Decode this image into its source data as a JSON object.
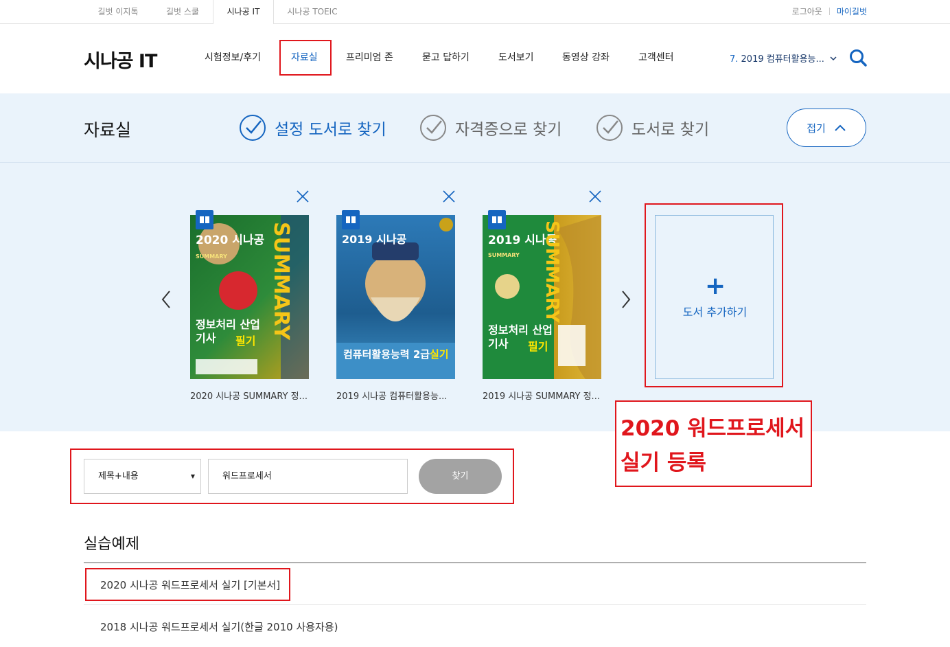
{
  "topbar": {
    "site_tabs": [
      "길벗 이지톡",
      "길벗 스쿨",
      "시나공 IT",
      "시나공 TOEIC"
    ],
    "logout": "로그아웃",
    "mypage": "마이길벗"
  },
  "header": {
    "logo": "시나공 IT",
    "nav": [
      "시험정보/후기",
      "자료실",
      "프리미엄 존",
      "묻고 답하기",
      "도서보기",
      "동영상 강좌",
      "고객센터"
    ],
    "book_select_num": "7.",
    "book_select_text": " 2019 컴퓨터활용능..."
  },
  "band": {
    "title": "자료실",
    "filters": [
      "설정 도서로 찾기",
      "자격증으로 찾기",
      "도서로 찾기"
    ],
    "fold_label": "접기"
  },
  "books": [
    {
      "title": "2020 시나공 SUMMARY 정...",
      "cover": {
        "series": "2020 시나공",
        "sub": "SUMMARY",
        "name": "정보처리 산업기사",
        "highlight": "필기",
        "side": "SUMMARY",
        "bg": "#2e8b3a"
      }
    },
    {
      "title": "2019 시나공 컴퓨터활용능...",
      "cover": {
        "series": "2019 시나공",
        "sub": "",
        "name": "컴퓨터활용능력 2급",
        "highlight": "실기",
        "side": "",
        "bg": "#2d7ab8"
      }
    },
    {
      "title": "2019 시나공 SUMMARY 정...",
      "cover": {
        "series": "2019 시나공",
        "sub": "SUMMARY",
        "name": "정보처리 산업기사",
        "highlight": "필기",
        "side": "SUMMARY",
        "bg": "#1f8a3c"
      }
    }
  ],
  "add_book": {
    "plus": "+",
    "label": "도서 추가하기"
  },
  "annotation": {
    "line1": "2020 워드프로세서",
    "line2": "실기 등록"
  },
  "search": {
    "select_value": "제목+내용",
    "caret": "▼",
    "query": "워드프로세서",
    "button": "찾기"
  },
  "results": {
    "section_title": "실습예제",
    "items": [
      "2020 시나공 워드프로세서 실기 [기본서]",
      "2018 시나공 워드프로세서 실기(한글 2010 사용자용)"
    ]
  },
  "colors": {
    "accent": "#1565c0",
    "highlight_red": "#e0161c",
    "band_bg": "#eaf3fb"
  }
}
